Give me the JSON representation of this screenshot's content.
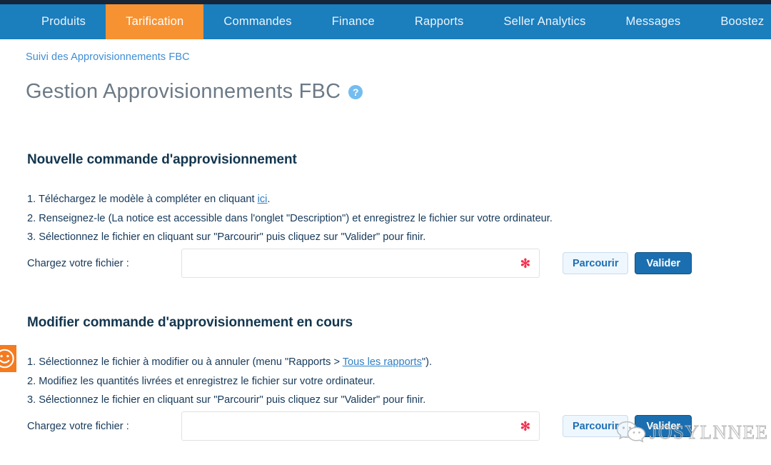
{
  "nav": {
    "items": [
      {
        "label": "Produits",
        "active": false
      },
      {
        "label": "Tarification",
        "active": true
      },
      {
        "label": "Commandes",
        "active": false
      },
      {
        "label": "Finance",
        "active": false
      },
      {
        "label": "Rapports",
        "active": false
      },
      {
        "label": "Seller Analytics",
        "active": false
      },
      {
        "label": "Messages",
        "active": false
      },
      {
        "label": "Boostez",
        "active": false
      }
    ],
    "accent_active": "#f79232",
    "background": "#1b7ebd",
    "top_strip": "#15263b"
  },
  "breadcrumb": "Suivi des Approvisionnements FBC",
  "page": {
    "title": "Gestion Approvisionnements FBC",
    "help_icon": "help-circle-icon",
    "help_glyph": "?"
  },
  "sections": [
    {
      "heading": "Nouvelle commande d'approvisionnement",
      "steps": [
        {
          "prefix": "1. Téléchargez le modèle à compléter en cliquant ",
          "link": "ici",
          "suffix": "."
        },
        {
          "prefix": "2. Renseignez-le (La notice est accessible dans l'onglet \"Description\") et enregistrez le fichier sur votre ordinateur.",
          "link": "",
          "suffix": ""
        },
        {
          "prefix": "3. Sélectionnez le fichier en cliquant sur \"Parcourir\" puis cliquez sur \"Valider\" pour finir.",
          "link": "",
          "suffix": ""
        }
      ],
      "upload": {
        "label": "Chargez votre fichier :",
        "value": "",
        "placeholder": "",
        "required_marker": "✻",
        "browse_label": "Parcourir",
        "submit_label": "Valider"
      }
    },
    {
      "heading": "Modifier commande d'approvisionnement en cours",
      "steps": [
        {
          "prefix": "1. Sélectionnez le fichier à modifier ou à annuler (menu \"Rapports > ",
          "link": "Tous les rapports",
          "suffix": "\")."
        },
        {
          "prefix": "2. Modifiez les quantités livrées et enregistrez le fichier sur votre ordinateur.",
          "link": "",
          "suffix": ""
        },
        {
          "prefix": "3. Sélectionnez le fichier en cliquant sur \"Parcourir\" puis cliquez sur \"Valider\" pour finir.",
          "link": "",
          "suffix": ""
        }
      ],
      "upload": {
        "label": "Chargez votre fichier :",
        "value": "",
        "placeholder": "",
        "required_marker": "✻",
        "browse_label": "Parcourir",
        "submit_label": "Valider"
      }
    }
  ],
  "side_tab": {
    "icon": "smiley-face-icon",
    "color": "#f47b20"
  },
  "watermark": {
    "text": "JOSYLNNEE",
    "icon": "wechat-logo-icon",
    "color": "#b9b9b9"
  }
}
